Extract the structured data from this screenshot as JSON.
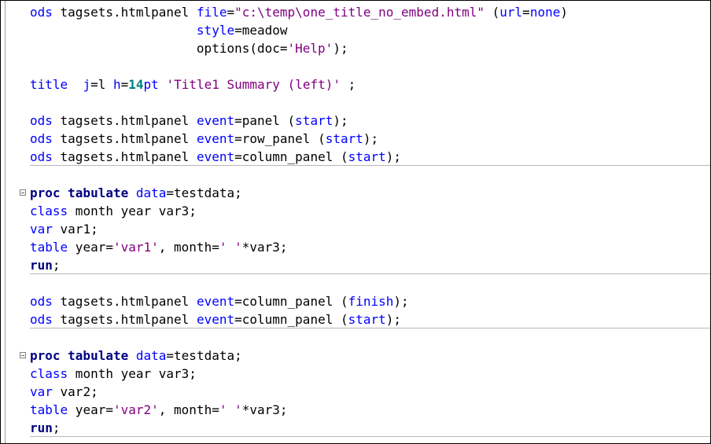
{
  "editor": {
    "lines": [
      {
        "fold": false,
        "sep": false,
        "tokens": [
          {
            "t": "ods",
            "c": "opt"
          },
          {
            "t": " tagsets.htmlpanel ",
            "c": "id"
          },
          {
            "t": "file",
            "c": "opt"
          },
          {
            "t": "=",
            "c": "id"
          },
          {
            "t": "\"c:\\temp\\one_title_no_embed.html\"",
            "c": "str"
          },
          {
            "t": " (",
            "c": "id"
          },
          {
            "t": "url",
            "c": "opt"
          },
          {
            "t": "=",
            "c": "id"
          },
          {
            "t": "none",
            "c": "opt"
          },
          {
            "t": ")",
            "c": "id"
          }
        ]
      },
      {
        "fold": false,
        "sep": false,
        "tokens": [
          {
            "t": "                      ",
            "c": "id"
          },
          {
            "t": "style",
            "c": "opt"
          },
          {
            "t": "=meadow",
            "c": "id"
          }
        ]
      },
      {
        "fold": false,
        "sep": false,
        "tokens": [
          {
            "t": "                      options(doc=",
            "c": "id"
          },
          {
            "t": "'Help'",
            "c": "str"
          },
          {
            "t": ");",
            "c": "id"
          }
        ]
      },
      {
        "fold": false,
        "sep": false,
        "tokens": []
      },
      {
        "fold": false,
        "sep": false,
        "tokens": [
          {
            "t": "title",
            "c": "opt"
          },
          {
            "t": "  ",
            "c": "id"
          },
          {
            "t": "j",
            "c": "opt"
          },
          {
            "t": "=l ",
            "c": "id"
          },
          {
            "t": "h",
            "c": "opt"
          },
          {
            "t": "=",
            "c": "id"
          },
          {
            "t": "14",
            "c": "num"
          },
          {
            "t": "pt",
            "c": "opt"
          },
          {
            "t": " ",
            "c": "id"
          },
          {
            "t": "'Title1 Summary (left)'",
            "c": "str"
          },
          {
            "t": " ;",
            "c": "id"
          }
        ]
      },
      {
        "fold": false,
        "sep": false,
        "tokens": []
      },
      {
        "fold": false,
        "sep": false,
        "tokens": [
          {
            "t": "ods",
            "c": "opt"
          },
          {
            "t": " tagsets.htmlpanel ",
            "c": "id"
          },
          {
            "t": "event",
            "c": "opt"
          },
          {
            "t": "=panel (",
            "c": "id"
          },
          {
            "t": "start",
            "c": "opt"
          },
          {
            "t": ");",
            "c": "id"
          }
        ]
      },
      {
        "fold": false,
        "sep": false,
        "tokens": [
          {
            "t": "ods",
            "c": "opt"
          },
          {
            "t": " tagsets.htmlpanel ",
            "c": "id"
          },
          {
            "t": "event",
            "c": "opt"
          },
          {
            "t": "=row_panel (",
            "c": "id"
          },
          {
            "t": "start",
            "c": "opt"
          },
          {
            "t": ");",
            "c": "id"
          }
        ]
      },
      {
        "fold": false,
        "sep": true,
        "tokens": [
          {
            "t": "ods",
            "c": "opt"
          },
          {
            "t": " tagsets.htmlpanel ",
            "c": "id"
          },
          {
            "t": "event",
            "c": "opt"
          },
          {
            "t": "=column_panel (",
            "c": "id"
          },
          {
            "t": "start",
            "c": "opt"
          },
          {
            "t": ");",
            "c": "id"
          }
        ]
      },
      {
        "fold": false,
        "sep": false,
        "tokens": []
      },
      {
        "fold": true,
        "sep": false,
        "tokens": [
          {
            "t": "proc tabulate",
            "c": "kw"
          },
          {
            "t": " ",
            "c": "id"
          },
          {
            "t": "data",
            "c": "opt"
          },
          {
            "t": "=testdata;",
            "c": "id"
          }
        ]
      },
      {
        "fold": false,
        "sep": false,
        "tokens": [
          {
            "t": "class",
            "c": "opt"
          },
          {
            "t": " month year var3;",
            "c": "id"
          }
        ]
      },
      {
        "fold": false,
        "sep": false,
        "tokens": [
          {
            "t": "var",
            "c": "opt"
          },
          {
            "t": " var1;",
            "c": "id"
          }
        ]
      },
      {
        "fold": false,
        "sep": false,
        "tokens": [
          {
            "t": "table",
            "c": "opt"
          },
          {
            "t": " year=",
            "c": "id"
          },
          {
            "t": "'var1'",
            "c": "str"
          },
          {
            "t": ", month=",
            "c": "id"
          },
          {
            "t": "' '",
            "c": "str"
          },
          {
            "t": "*var3;",
            "c": "id"
          }
        ]
      },
      {
        "fold": false,
        "sep": true,
        "tokens": [
          {
            "t": "run",
            "c": "kw"
          },
          {
            "t": ";",
            "c": "id"
          }
        ]
      },
      {
        "fold": false,
        "sep": false,
        "tokens": []
      },
      {
        "fold": false,
        "sep": false,
        "tokens": [
          {
            "t": "ods",
            "c": "opt"
          },
          {
            "t": " tagsets.htmlpanel ",
            "c": "id"
          },
          {
            "t": "event",
            "c": "opt"
          },
          {
            "t": "=column_panel (",
            "c": "id"
          },
          {
            "t": "finish",
            "c": "opt"
          },
          {
            "t": ");",
            "c": "id"
          }
        ]
      },
      {
        "fold": false,
        "sep": true,
        "tokens": [
          {
            "t": "ods",
            "c": "opt"
          },
          {
            "t": " tagsets.htmlpanel ",
            "c": "id"
          },
          {
            "t": "event",
            "c": "opt"
          },
          {
            "t": "=column_panel (",
            "c": "id"
          },
          {
            "t": "start",
            "c": "opt"
          },
          {
            "t": ");",
            "c": "id"
          }
        ]
      },
      {
        "fold": false,
        "sep": false,
        "tokens": []
      },
      {
        "fold": true,
        "sep": false,
        "tokens": [
          {
            "t": "proc tabulate",
            "c": "kw"
          },
          {
            "t": " ",
            "c": "id"
          },
          {
            "t": "data",
            "c": "opt"
          },
          {
            "t": "=testdata;",
            "c": "id"
          }
        ]
      },
      {
        "fold": false,
        "sep": false,
        "tokens": [
          {
            "t": "class",
            "c": "opt"
          },
          {
            "t": " month year var3;",
            "c": "id"
          }
        ]
      },
      {
        "fold": false,
        "sep": false,
        "tokens": [
          {
            "t": "var",
            "c": "opt"
          },
          {
            "t": " var2;",
            "c": "id"
          }
        ]
      },
      {
        "fold": false,
        "sep": false,
        "tokens": [
          {
            "t": "table",
            "c": "opt"
          },
          {
            "t": " year=",
            "c": "id"
          },
          {
            "t": "'var2'",
            "c": "str"
          },
          {
            "t": ", month=",
            "c": "id"
          },
          {
            "t": "' '",
            "c": "str"
          },
          {
            "t": "*var3;",
            "c": "id"
          }
        ]
      },
      {
        "fold": false,
        "sep": true,
        "tokens": [
          {
            "t": "run",
            "c": "kw"
          },
          {
            "t": ";",
            "c": "id"
          }
        ]
      }
    ]
  }
}
